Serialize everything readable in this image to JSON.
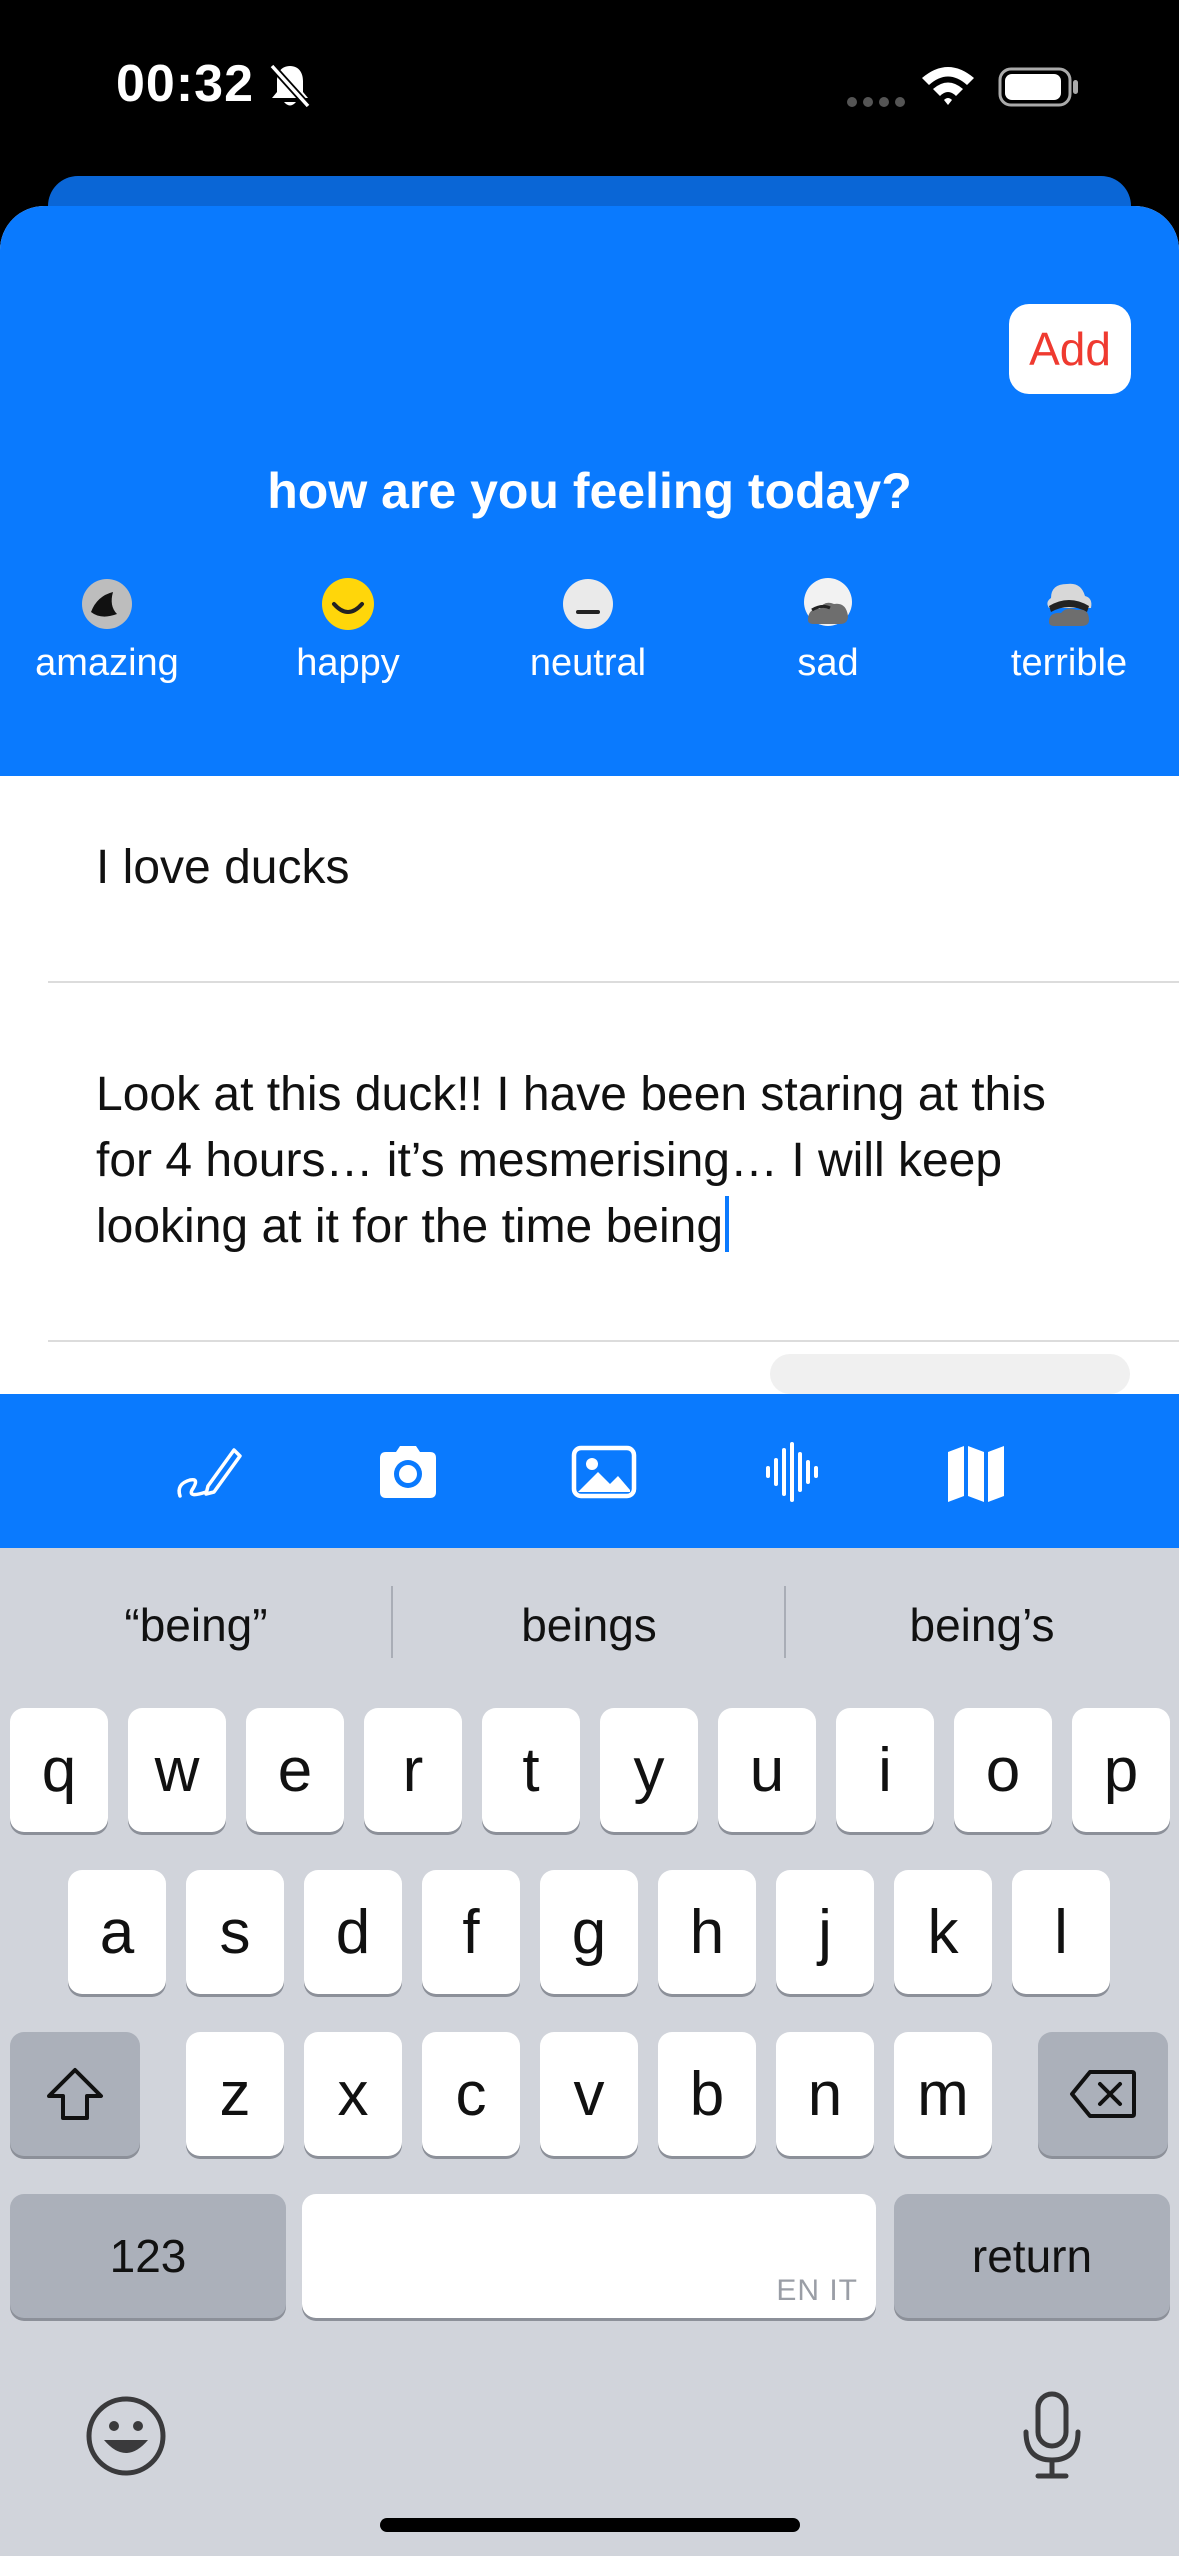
{
  "status_bar": {
    "time": "00:32"
  },
  "colors": {
    "accent": "#0a7afe",
    "add_text": "#ef3a30",
    "keyboard_bg": "#d1d4db",
    "mood_happy": "#ffd60a"
  },
  "header": {
    "add_label": "Add",
    "prompt": "how are you feeling today?"
  },
  "moods": [
    {
      "label": "amazing",
      "icon": "moon-icon"
    },
    {
      "label": "happy",
      "icon": "smiley-icon"
    },
    {
      "label": "neutral",
      "icon": "neutral-face-icon"
    },
    {
      "label": "sad",
      "icon": "cloudy-icon"
    },
    {
      "label": "terrible",
      "icon": "storm-icon"
    }
  ],
  "entry": {
    "title": "I love ducks",
    "body": "Look at this duck!! I have been staring at this for 4 hours… it’s mesmerising… I will keep looking at it for the time being"
  },
  "toolbar": {
    "tools": [
      "pencil-icon",
      "camera-icon",
      "photo-icon",
      "waveform-icon",
      "map-icon"
    ]
  },
  "keyboard": {
    "suggestions": [
      "“being”",
      "beings",
      "being’s"
    ],
    "row1": [
      "q",
      "w",
      "e",
      "r",
      "t",
      "y",
      "u",
      "i",
      "o",
      "p"
    ],
    "row2": [
      "a",
      "s",
      "d",
      "f",
      "g",
      "h",
      "j",
      "k",
      "l"
    ],
    "row3": [
      "z",
      "x",
      "c",
      "v",
      "b",
      "n",
      "m"
    ],
    "numbers_label": "123",
    "return_label": "return",
    "space_lang": "EN IT"
  }
}
